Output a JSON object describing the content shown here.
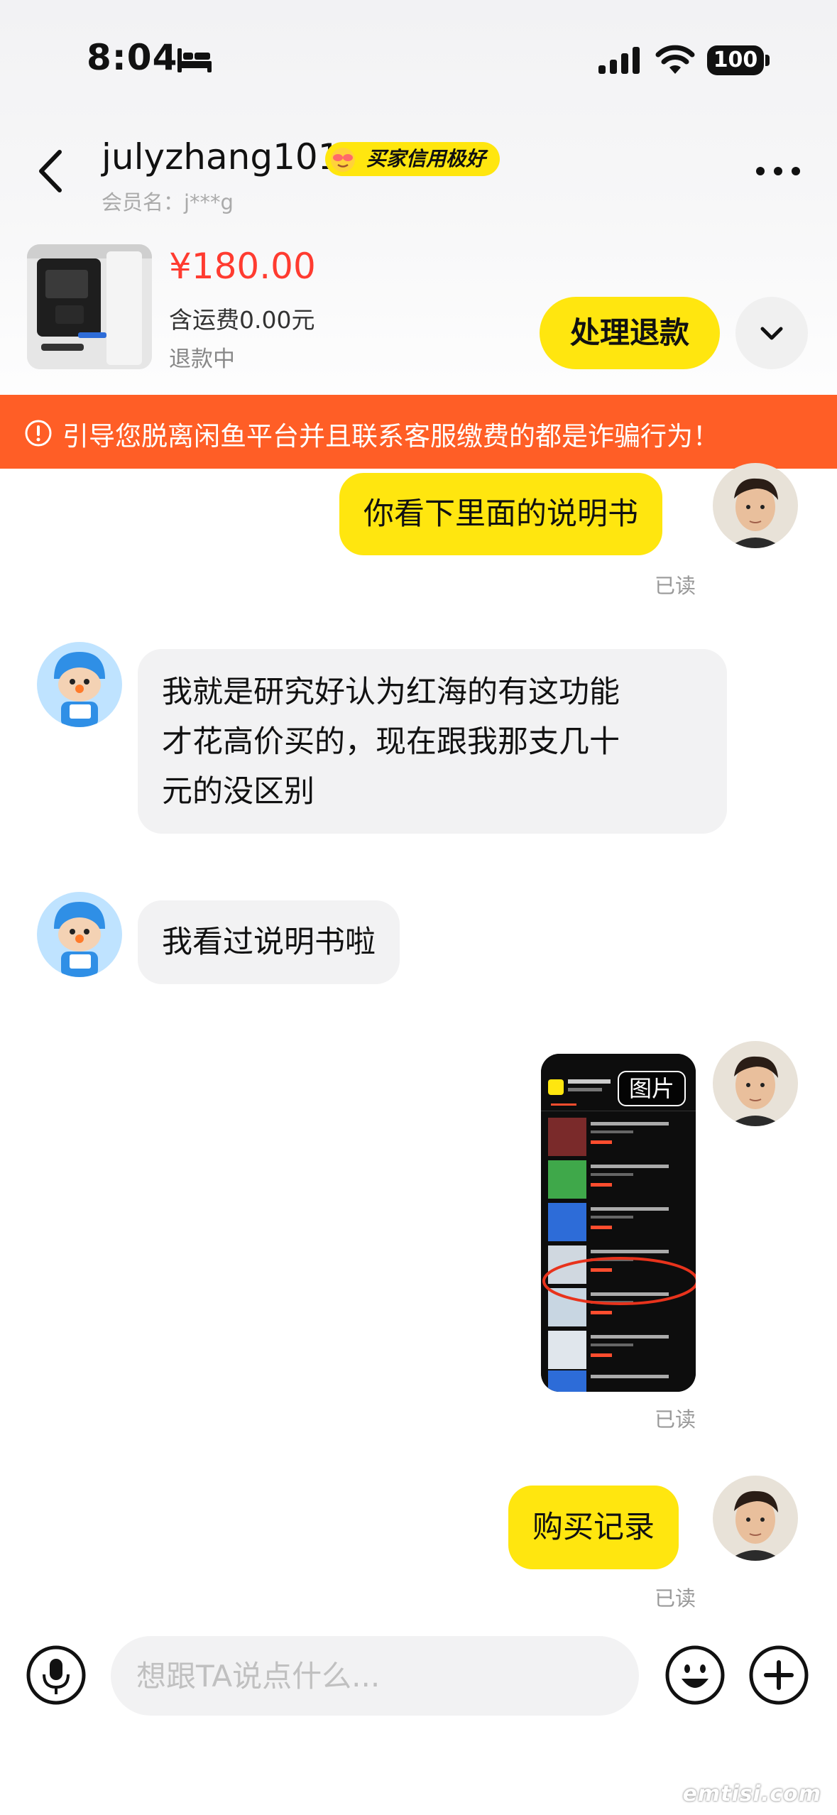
{
  "status_bar": {
    "time": "8:04",
    "battery": "100"
  },
  "header": {
    "username": "julyzhang101",
    "credit_badge": "买家信用极好",
    "member_name": "会员名：j***g"
  },
  "product": {
    "price": "¥180.00",
    "shipping": "含运费0.00元",
    "status": "退款中",
    "refund_button": "处理退款"
  },
  "warning": {
    "text": "引导您脱离闲鱼平台并且联系客服缴费的都是诈骗行为！"
  },
  "messages": [
    {
      "from": "me",
      "text": "你看下里面的说明书",
      "read": "已读"
    },
    {
      "from": "other",
      "lines": [
        "我就是研究好认为红海的有这功能",
        "才花高价买的，现在跟我那支几十",
        "元的没区别"
      ]
    },
    {
      "from": "other",
      "text": "我看过说明书啦"
    },
    {
      "from": "me",
      "image_tag": "图片",
      "read": "已读"
    },
    {
      "from": "me",
      "text": "购买记录",
      "read": "已读"
    }
  ],
  "input": {
    "placeholder": "想跟TA说点什么..."
  },
  "watermark": "emtisi.com",
  "colors": {
    "accent_yellow": "#ffe60f",
    "warning_orange": "#ff5e26",
    "price_red": "#ff3b30"
  }
}
